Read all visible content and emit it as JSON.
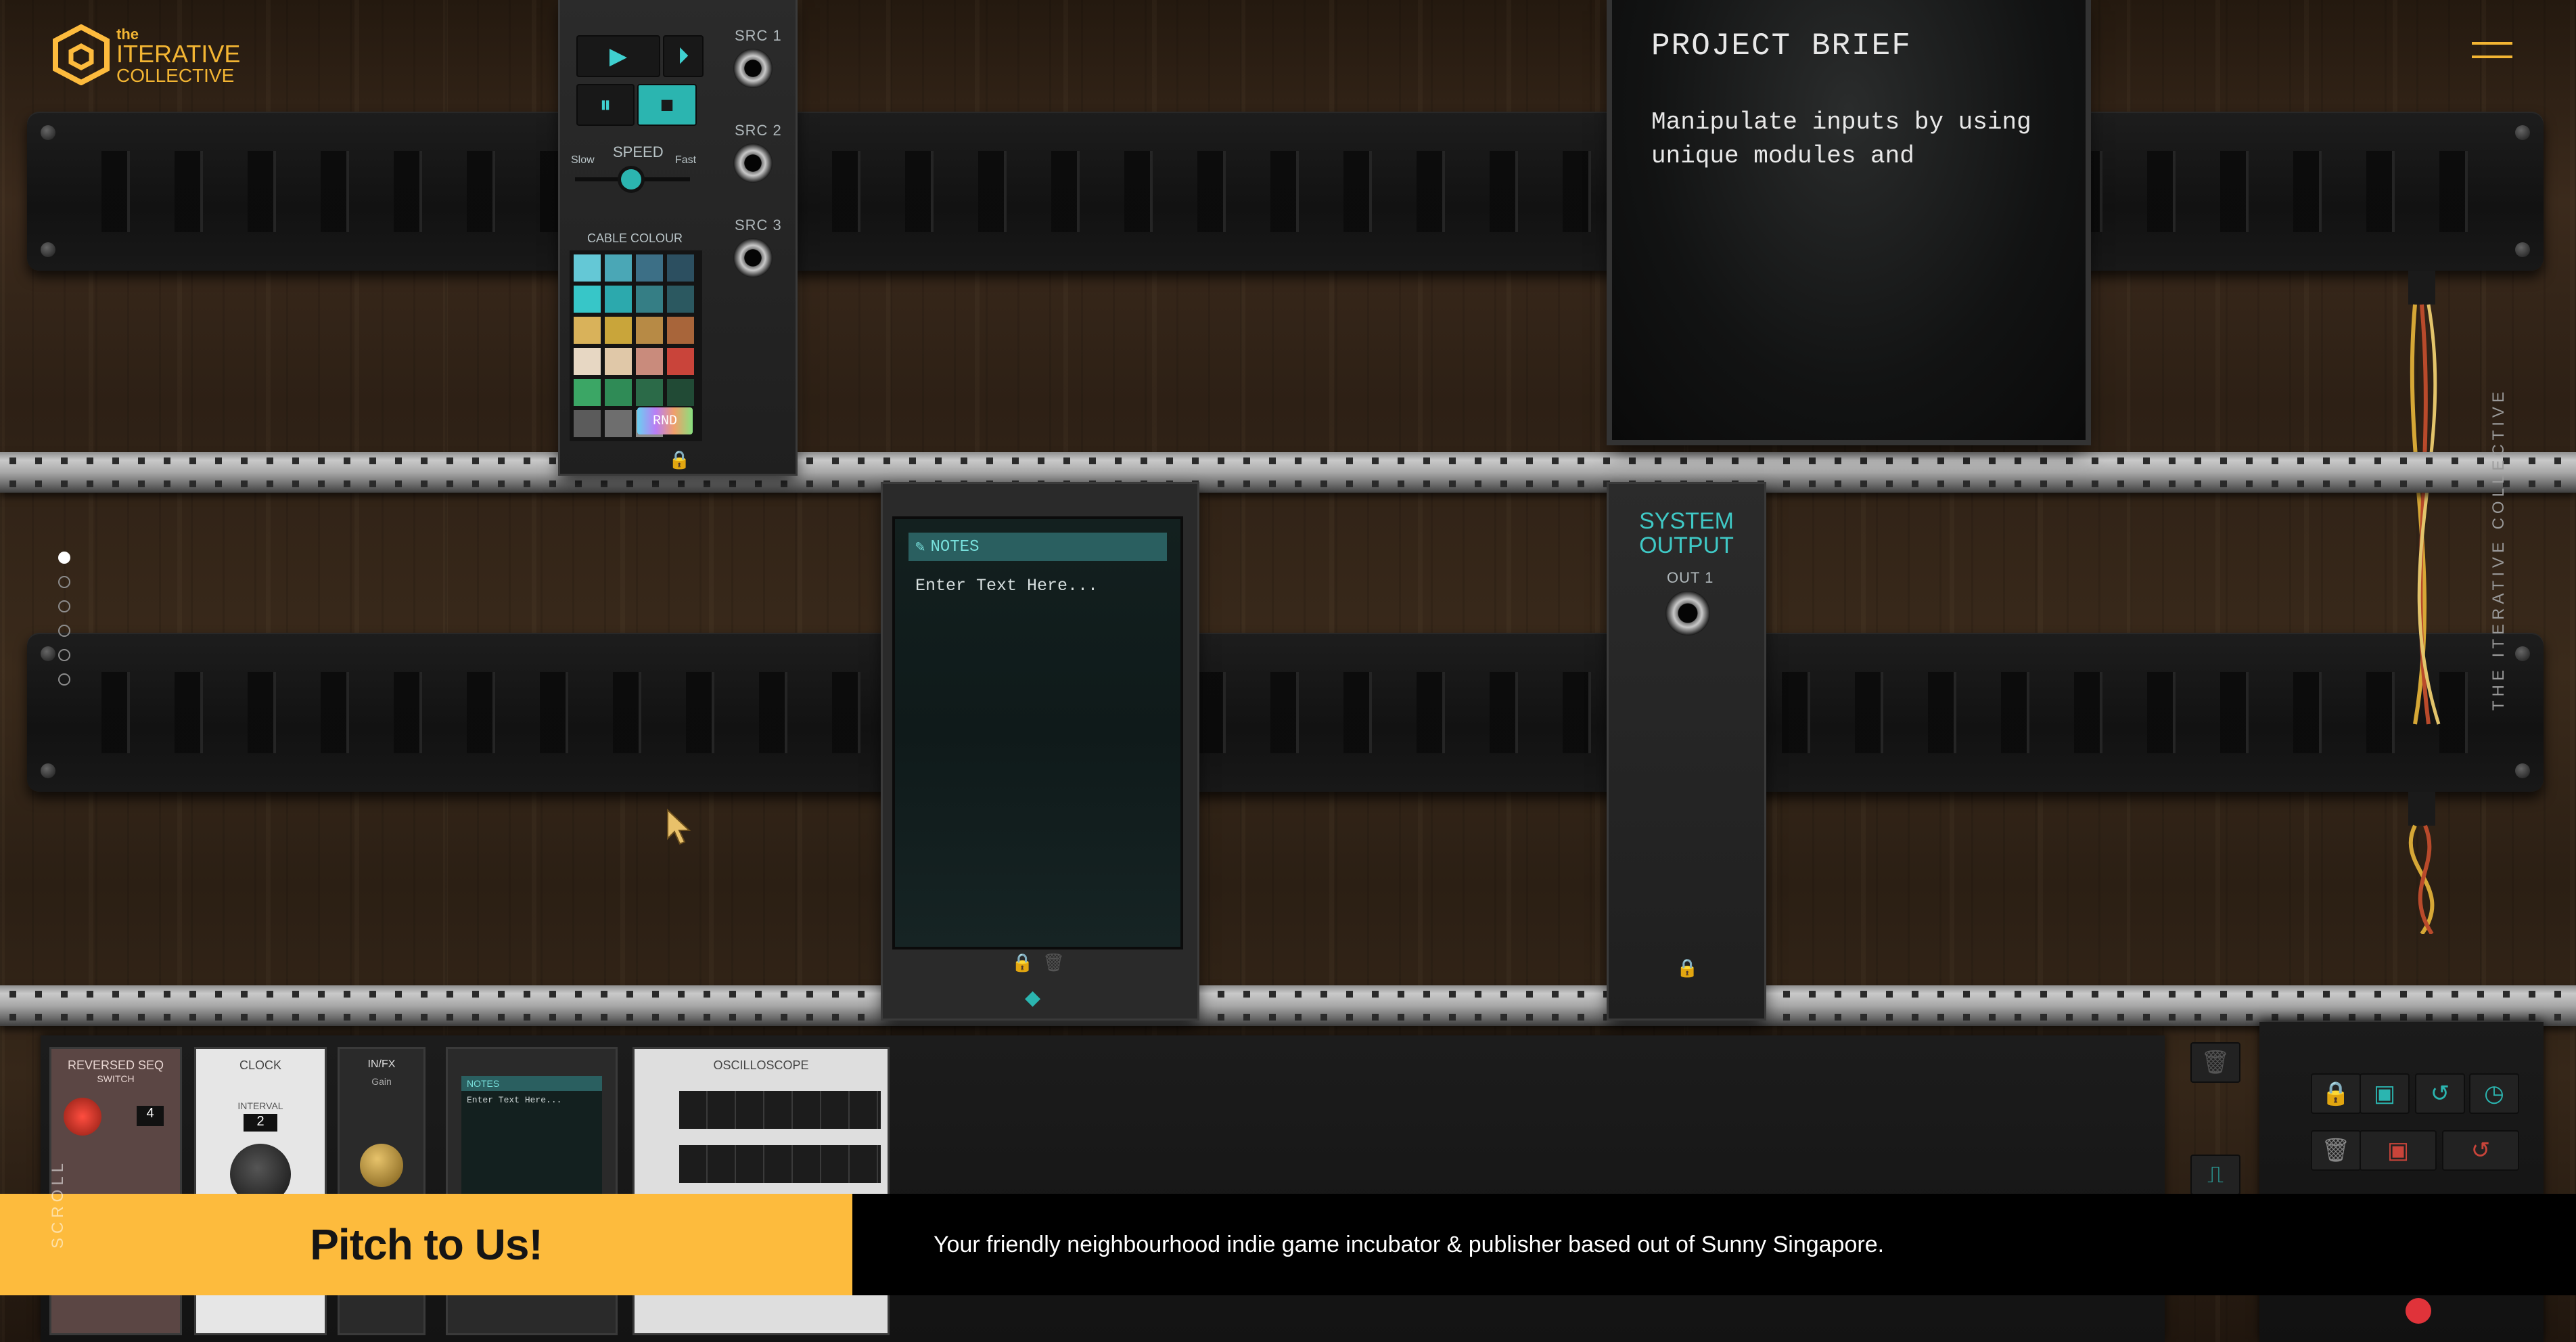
{
  "brand": {
    "prefix": "the",
    "line1": "ITERATIVE",
    "line2": "COLLECTIVE",
    "vertical": "THE ITERATIVE COLLECTIVE",
    "accent": "#fdbb3d"
  },
  "transport": {
    "play_icon": "▶",
    "step_icon": "⏵",
    "pause_icon": "⏸",
    "stop_icon": "■",
    "speed_label": "SPEED",
    "slow_label": "Slow",
    "fast_label": "Fast",
    "cable_colour_label": "CABLE COLOUR",
    "random_label": "RND",
    "src_labels": [
      "SRC 1",
      "SRC 2",
      "SRC 3"
    ]
  },
  "brief": {
    "title": "PROJECT BRIEF",
    "body_line1": "Manipulate inputs by using",
    "body_line2": "unique modules and"
  },
  "notes": {
    "title": "NOTES",
    "placeholder": "Enter Text Here..."
  },
  "system_output": {
    "title_line1": "SYSTEM",
    "title_line2": "OUTPUT",
    "out_label": "OUT 1"
  },
  "tray": {
    "modules": [
      {
        "label_line1": "REVERSED SEQ",
        "label_line2": "SWITCH",
        "value": "4"
      },
      {
        "label_line1": "CLOCK",
        "label_line2": "INTERVAL",
        "value": "2"
      },
      {
        "label_line1": "IN/FX",
        "label_line2": "Gain"
      },
      {
        "label_line1": "NOTES",
        "label_line2": "Enter Text Here..."
      },
      {
        "label_line1": "OSCILLOSCOPE",
        "label_line2": ""
      }
    ]
  },
  "pagination": {
    "count": 6,
    "active": 0
  },
  "banner": {
    "pitch_label": "Pitch to Us!",
    "tagline": "Your friendly neighbourhood indie game incubator & publisher based out of Sunny Singapore.",
    "scroll_hint": "SCROLL"
  },
  "colors": {
    "teal": "#2bb5b0",
    "rail": "#b5b5b5",
    "swatches": [
      "#64c8d6",
      "#4aa7b6",
      "#3c6f86",
      "#2c4f60",
      "#37c6c8",
      "#2ca9ad",
      "#357e85",
      "#2b5860",
      "#d9b25a",
      "#c9a53a",
      "#b78a45",
      "#a8653a",
      "#e7d7c3",
      "#e0c8a8",
      "#c98b7c",
      "#c9443a",
      "#3ba665",
      "#2f8b56",
      "#2b6a48",
      "#214a35",
      "#5b5b5b",
      "#6e6e6e",
      "#8a8a8a"
    ]
  }
}
